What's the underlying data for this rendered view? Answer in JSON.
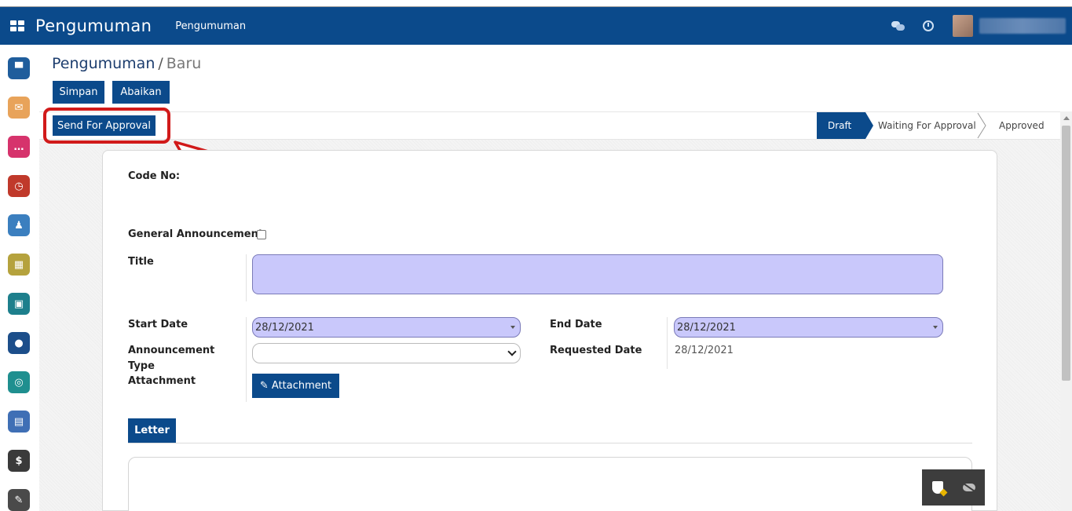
{
  "navbar": {
    "brand": "Pengumuman",
    "menu_item": "Pengumuman"
  },
  "breadcrumb": {
    "parent": "Pengumuman",
    "separator": "/",
    "current": "Baru"
  },
  "actions": {
    "save": "Simpan",
    "discard": "Abaikan",
    "send_for_approval": "Send For Approval"
  },
  "stages": {
    "draft": "Draft",
    "waiting": "Waiting For Approval",
    "approved": "Approved",
    "active": "Draft"
  },
  "form": {
    "code_no_label": "Code No:",
    "general_announcement_label": "General Announcement",
    "general_announcement_checked": false,
    "title_label": "Title",
    "title_value": "",
    "start_date_label": "Start Date",
    "start_date_value": "28/12/2021",
    "end_date_label": "End Date",
    "end_date_value": "28/12/2021",
    "announcement_type_label_1": "Announcement",
    "announcement_type_label_2": "Type",
    "announcement_type_value": "",
    "requested_date_label": "Requested Date",
    "requested_date_value": "28/12/2021",
    "attachment_label": "Attachment",
    "attachment_button": "✎ Attachment"
  },
  "tabs": {
    "letter": "Letter"
  },
  "colors": {
    "primary": "#0b4a8b",
    "required_field": "#c9c8fb",
    "highlight": "#d11a1a"
  },
  "apps": [
    {
      "icon": "presentation-icon",
      "color": "#1f5d9c",
      "glyph": "▀"
    },
    {
      "icon": "inbox-icon",
      "color": "#e8a35a",
      "glyph": "✉"
    },
    {
      "icon": "chat-icon",
      "color": "#d6336c",
      "glyph": "…"
    },
    {
      "icon": "stopwatch-icon",
      "color": "#c0392b",
      "glyph": "◷"
    },
    {
      "icon": "user-clock-icon",
      "color": "#3b7fbf",
      "glyph": "♟"
    },
    {
      "icon": "calendar-icon",
      "color": "#b5a23d",
      "glyph": "▦"
    },
    {
      "icon": "monitor-icon",
      "color": "#1d7f8c",
      "glyph": "▣"
    },
    {
      "icon": "badge-icon",
      "color": "#1c4e8a",
      "glyph": "●"
    },
    {
      "icon": "dashboard-icon",
      "color": "#1f8f8f",
      "glyph": "◎"
    },
    {
      "icon": "box-icon",
      "color": "#3f6fb5",
      "glyph": "▤"
    },
    {
      "icon": "payroll-icon",
      "color": "#3a3a3a",
      "glyph": "$"
    },
    {
      "icon": "edit-icon",
      "color": "#4a4a4a",
      "glyph": "✎"
    }
  ]
}
